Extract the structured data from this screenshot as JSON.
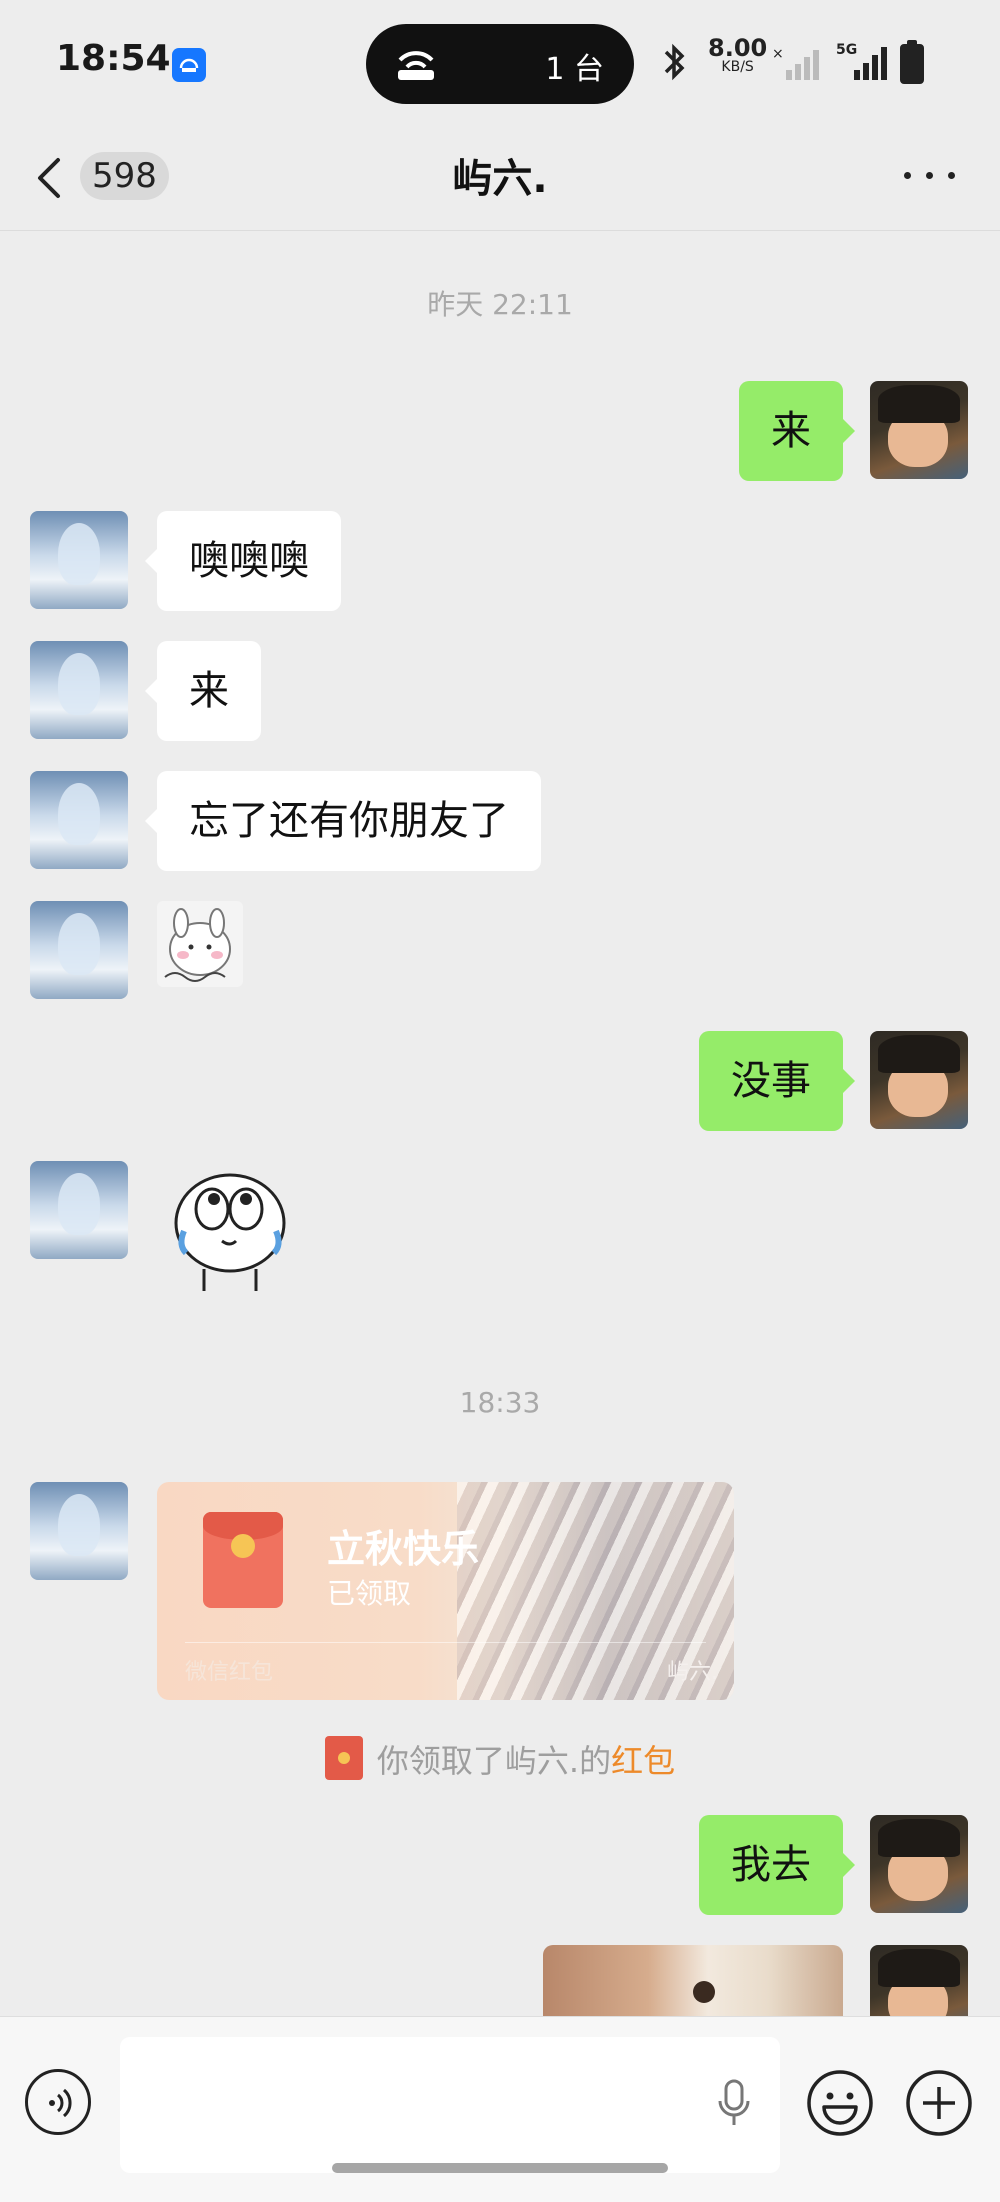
{
  "status_bar": {
    "time": "18:54",
    "island_count": "1 台",
    "network_speed": "8.00",
    "network_speed_unit": "KB/S",
    "network_type": "5G"
  },
  "nav": {
    "unread_count": "598",
    "title": "屿六."
  },
  "chat": {
    "timestamps": [
      "昨天 22:11",
      "18:33"
    ],
    "messages": [
      {
        "from": "me",
        "text": "来"
      },
      {
        "from": "other",
        "text": "噢噢噢"
      },
      {
        "from": "other",
        "text": "来"
      },
      {
        "from": "other",
        "text": "忘了还有你朋友了"
      },
      {
        "from": "other",
        "type": "sticker",
        "icon": "bunny-sticker"
      },
      {
        "from": "me",
        "text": "没事"
      },
      {
        "from": "other",
        "type": "sticker",
        "icon": "crying-creature-sticker"
      },
      {
        "from": "other",
        "type": "red_packet",
        "title": "立秋快乐",
        "status": "已领取",
        "footer": "微信红包",
        "sender_tag": "屿六."
      },
      {
        "from": "me",
        "text": "我去"
      },
      {
        "from": "me",
        "type": "image",
        "icon": "dog-photo"
      }
    ],
    "system_notice": {
      "prefix": "你领取了屿六.的",
      "link": "红包"
    }
  },
  "input": {
    "placeholder": ""
  },
  "colors": {
    "background": "#ededed",
    "bubble_out": "#95ec69",
    "bubble_in": "#ffffff",
    "red_packet_link": "#ed8a2a",
    "red_packet": "#e35a48"
  }
}
